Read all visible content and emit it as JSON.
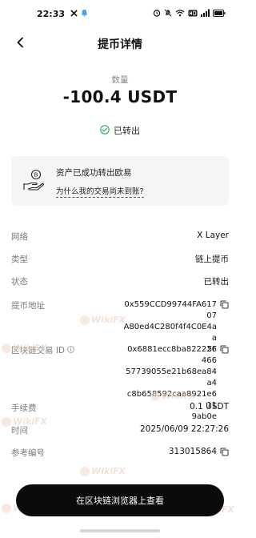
{
  "status_bar": {
    "time": "22:33"
  },
  "nav": {
    "title": "提币详情"
  },
  "summary": {
    "amount_label": "数量",
    "amount": "-100.4 USDT",
    "status": "已转出"
  },
  "notice": {
    "title": "资产已成功转出欧易",
    "link": "为什么我的交易尚未到账?"
  },
  "details": {
    "network": {
      "label": "网络",
      "value": "X Layer"
    },
    "type": {
      "label": "类型",
      "value": "链上提币"
    },
    "state": {
      "label": "状态",
      "value": "已转出"
    },
    "address": {
      "label": "提币地址",
      "lines": [
        "0x559CCD99744FA61707",
        "A80ed4C280f4f4C0E4aa",
        "5F"
      ]
    },
    "txid": {
      "label": "区块链交易 ID",
      "lines": [
        "0x6881ecc8ba822226466",
        "57739055e21b68ea84a4",
        "c8b658592caa8921e611",
        "9ab0e"
      ]
    },
    "fee": {
      "label": "手续费",
      "value": "0.1 USDT"
    },
    "time": {
      "label": "时间",
      "value": "2025/06/09 22:27:26"
    },
    "ref": {
      "label": "参考编号",
      "value": "313015864"
    }
  },
  "cta": {
    "label": "在区块链浏览器上查看"
  },
  "watermark": "WikiFX",
  "colors": {
    "success": "#22a45d",
    "button": "#0b0b0b"
  },
  "icons": {
    "back": "chevron-left-icon",
    "status": "check-circle-icon",
    "notice": "hand-coin-icon",
    "copy": "copy-icon",
    "info": "info-icon"
  }
}
